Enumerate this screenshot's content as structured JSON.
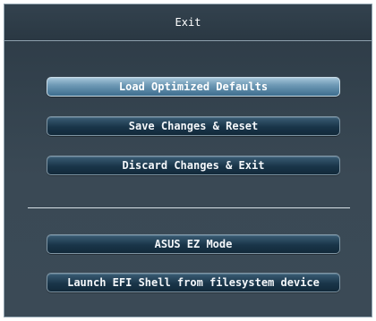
{
  "dialog": {
    "title": "Exit",
    "options": [
      {
        "label": "Load Optimized Defaults",
        "selected": true
      },
      {
        "label": "Save Changes & Reset",
        "selected": false
      },
      {
        "label": "Discard Changes & Exit",
        "selected": false
      }
    ],
    "extra_options": [
      {
        "label": "ASUS EZ Mode"
      },
      {
        "label": "Launch EFI Shell from filesystem device"
      }
    ]
  },
  "colors": {
    "panel_background": "#364450",
    "button_background": "#193549",
    "selected_button_background": "#6f9ab6",
    "text": "#ffffff"
  }
}
